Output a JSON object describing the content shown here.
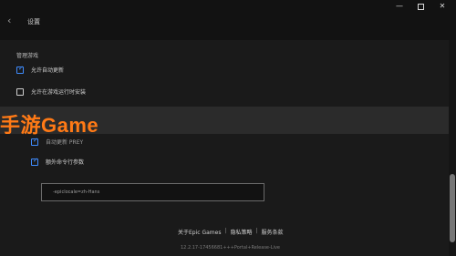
{
  "header": {
    "title": "设置"
  },
  "window_controls": {
    "min": "—",
    "close": "✕"
  },
  "section": {
    "title": "管理游戏",
    "items": [
      {
        "label": "允许自动更新",
        "checked": true
      },
      {
        "label": "允许在游戏运行时安装",
        "checked": false
      }
    ]
  },
  "game": {
    "items": [
      {
        "label": "自动更新 PREY",
        "checked": true
      },
      {
        "label": "额外命令行参数",
        "checked": true
      }
    ],
    "args_value": "-epiclocale=zh-Hans"
  },
  "watermark": {
    "text": "手游Game"
  },
  "footer": {
    "links": [
      "关于Epic Games",
      "隐私策略",
      "服务条款"
    ],
    "separator": "|",
    "version": "12.2.17-17456681+++Portal+Release-Live"
  }
}
